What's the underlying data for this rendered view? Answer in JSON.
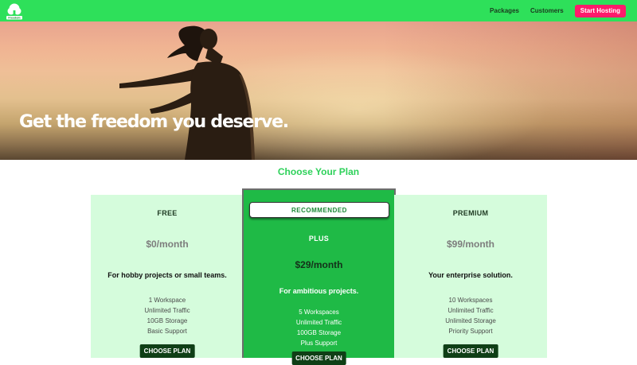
{
  "header": {
    "logo_icon": "tree-logo-icon",
    "logo_text": "Freedom",
    "nav": [
      {
        "label": "Packages"
      },
      {
        "label": "Customers"
      }
    ],
    "cta_label": "Start Hosting",
    "colors": {
      "bar": "#2ee05a",
      "cta": "#ff1b6b"
    }
  },
  "hero": {
    "title": "Get the freedom you deserve."
  },
  "plans_section": {
    "title": "Choose Your Plan",
    "plans": [
      {
        "name": "FREE",
        "price": "$0/month",
        "description": "For hobby projects or small teams.",
        "features": [
          "1 Workspace",
          "Unlimited Traffic",
          "10GB Storage",
          "Basic Support"
        ],
        "button": "CHOOSE PLAN"
      },
      {
        "badge": "RECOMMENDED",
        "name": "PLUS",
        "price": "$29/month",
        "description": "For ambitious projects.",
        "features": [
          "5 Workspaces",
          "Unlimited Traffic",
          "100GB Storage",
          "Plus Support"
        ],
        "button": "CHOOSE PLAN"
      },
      {
        "name": "PREMIUM",
        "price": "$99/month",
        "description": "Your enterprise solution.",
        "features": [
          "10 Workspaces",
          "Unlimited Traffic",
          "Unlimited Storage",
          "Priority Support"
        ],
        "button": "CHOOSE PLAN"
      }
    ]
  }
}
